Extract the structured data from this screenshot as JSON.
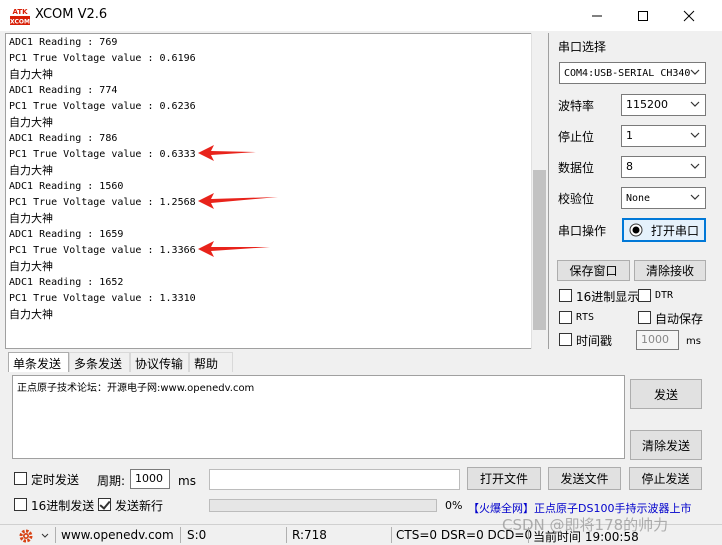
{
  "window": {
    "title": "XCOM V2.6",
    "logo_text": "ATK XCOM"
  },
  "receive": {
    "lines": [
      "ADC1 Reading : 769",
      "PC1 True Voltage value : 0.6196",
      "自力大神",
      "ADC1 Reading : 774",
      "PC1 True Voltage value : 0.6236",
      "自力大神",
      "ADC1 Reading : 786",
      "PC1 True Voltage value : 0.6333",
      "自力大神",
      "ADC1 Reading : 1560",
      "PC1 True Voltage value : 1.2568",
      "自力大神",
      "ADC1 Reading : 1659",
      "PC1 True Voltage value : 1.3366",
      "自力大神",
      "ADC1 Reading : 1652",
      "PC1 True Voltage value : 1.3310",
      "自力大神"
    ]
  },
  "panel": {
    "port_select_label": "串口选择",
    "port_value": "COM4:USB-SERIAL CH340",
    "baud_label": "波特率",
    "baud_value": "115200",
    "stop_label": "停止位",
    "stop_value": "1",
    "data_label": "数据位",
    "data_value": "8",
    "parity_label": "校验位",
    "parity_value": "None",
    "op_label": "串口操作",
    "open_button": "打开串口",
    "save_window": "保存窗口",
    "clear_receive": "清除接收",
    "hex_display": "16进制显示",
    "dtr": "DTR",
    "rts": "RTS",
    "auto_save": "自动保存",
    "timestamp": "时间戳",
    "timestamp_value": "1000",
    "ms": "ms"
  },
  "tabs": [
    "单条发送",
    "多条发送",
    "协议传输",
    "帮助"
  ],
  "send": {
    "text": "正点原子技术论坛：开源电子网:www.openedv.com",
    "send_button": "发送",
    "clear_send": "清除发送",
    "timed_send": "定时发送",
    "period_label": "周期:",
    "period_value": "1000",
    "ms": "ms",
    "open_file": "打开文件",
    "send_file": "发送文件",
    "stop_send": "停止发送",
    "hex_send": "16进制发送",
    "send_newline": "发送新行",
    "progress_pct": "0%",
    "progress_value": 0,
    "ad_text": "【火爆全网】正点原子DS100手持示波器上市"
  },
  "status": {
    "url": "www.openedv.com",
    "s": "S:0",
    "r": "R:718",
    "lines": "CTS=0 DSR=0 DCD=0",
    "time": "当前时间 19:00:58"
  },
  "watermark": "CSDN @即将178的帅力",
  "colors": {
    "arrow": "#e8231b",
    "ad": "#0000cc"
  }
}
